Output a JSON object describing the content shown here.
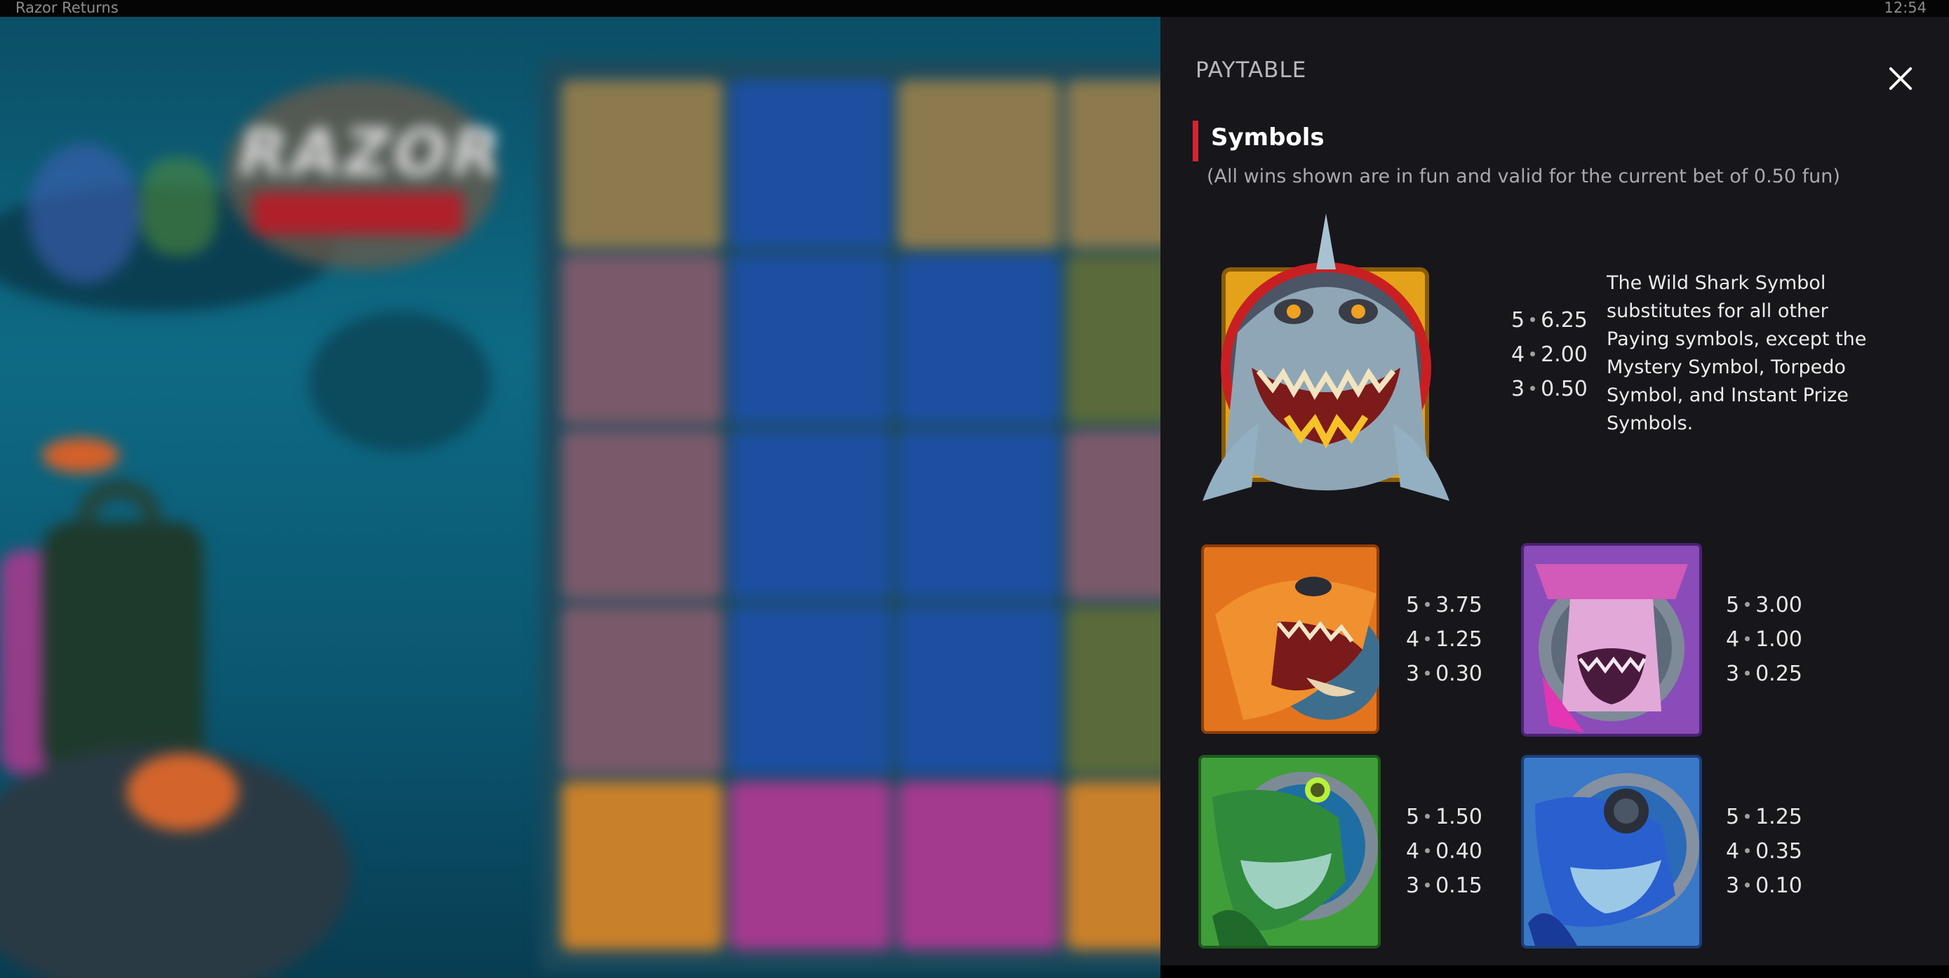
{
  "window": {
    "title": "Razor Returns",
    "clock": "12:54"
  },
  "game_background": {
    "logo_text": "RAZOR"
  },
  "paytable": {
    "header": "PAYTABLE",
    "close_icon": "close-icon",
    "section": {
      "title": "Symbols",
      "note": "(All wins shown are in fun and valid for the current bet of 0.50 fun)"
    },
    "accent_color": "#d6232f",
    "symbols": {
      "wild": {
        "icon": "wild-shark-icon",
        "pays": [
          {
            "count": "5",
            "value": "6.25"
          },
          {
            "count": "4",
            "value": "2.00"
          },
          {
            "count": "3",
            "value": "0.50"
          }
        ],
        "description": "The Wild Shark Symbol substitutes for all other Paying symbols, except the Mystery Symbol, Torpedo Symbol, and Instant Prize Symbols."
      },
      "orange": {
        "icon": "orange-shark-icon",
        "pays": [
          {
            "count": "5",
            "value": "3.75"
          },
          {
            "count": "4",
            "value": "1.25"
          },
          {
            "count": "3",
            "value": "0.30"
          }
        ]
      },
      "pink": {
        "icon": "pink-hammerhead-icon",
        "pays": [
          {
            "count": "5",
            "value": "3.00"
          },
          {
            "count": "4",
            "value": "1.00"
          },
          {
            "count": "3",
            "value": "0.25"
          }
        ]
      },
      "green": {
        "icon": "green-shark-icon",
        "pays": [
          {
            "count": "5",
            "value": "1.50"
          },
          {
            "count": "4",
            "value": "0.40"
          },
          {
            "count": "3",
            "value": "0.15"
          }
        ]
      },
      "blue": {
        "icon": "blue-shark-icon",
        "pays": [
          {
            "count": "5",
            "value": "1.25"
          },
          {
            "count": "4",
            "value": "0.35"
          },
          {
            "count": "3",
            "value": "0.10"
          }
        ]
      }
    }
  }
}
